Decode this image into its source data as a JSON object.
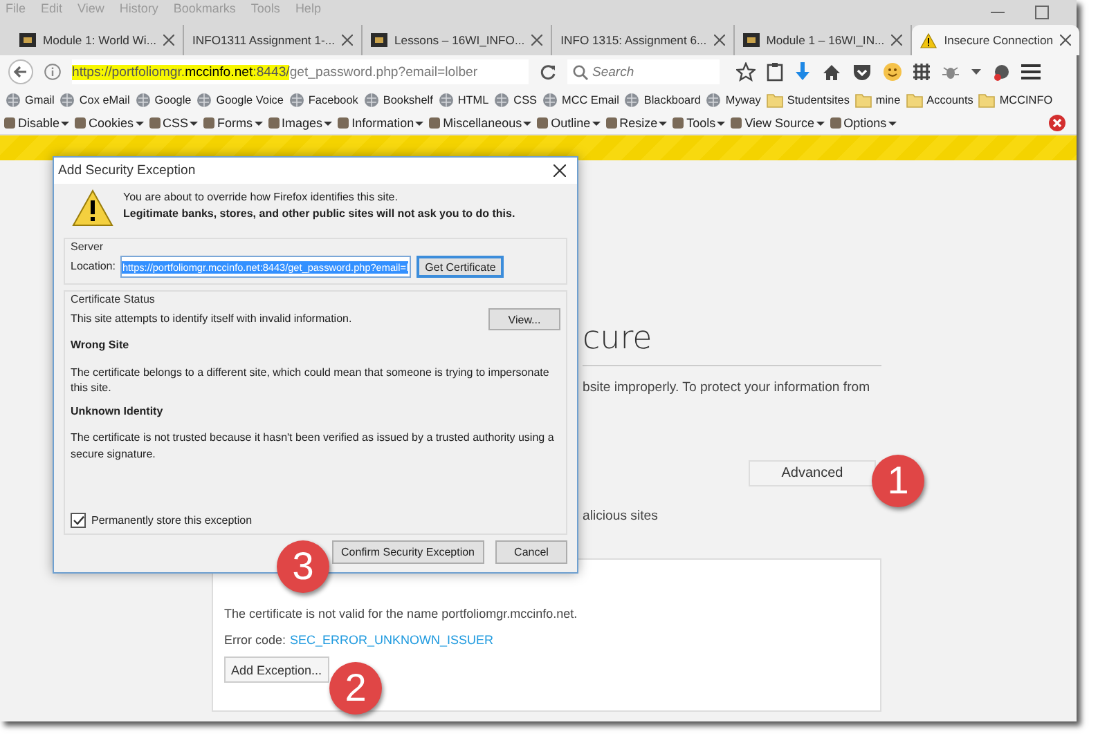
{
  "menu": [
    "File",
    "Edit",
    "View",
    "History",
    "Bookmarks",
    "Tools",
    "Help"
  ],
  "tabs": [
    {
      "title": "Module 1: World Wi...",
      "kind": "site",
      "selected": false
    },
    {
      "title": "INFO1311 Assignment 1-...",
      "kind": "plain",
      "selected": false
    },
    {
      "title": "Lessons – 16WI_INFO...",
      "kind": "site",
      "selected": false
    },
    {
      "title": "INFO 1315: Assignment 6...",
      "kind": "plain",
      "selected": false
    },
    {
      "title": "Module 1 – 16WI_IN...",
      "kind": "site",
      "selected": false
    },
    {
      "title": "Insecure Connection",
      "kind": "warning",
      "selected": true
    }
  ],
  "address": {
    "highlighted": "https://portfoliomgr.**mccinfo.net**:8443/",
    "rest": "get_password.php?email=lolber"
  },
  "search": {
    "placeholder": "Search"
  },
  "bookmarks": [
    {
      "label": "Gmail",
      "kind": "site"
    },
    {
      "label": "Cox eMail",
      "kind": "site"
    },
    {
      "label": "Google",
      "kind": "site"
    },
    {
      "label": "Google Voice",
      "kind": "site"
    },
    {
      "label": "Facebook",
      "kind": "site"
    },
    {
      "label": "Bookshelf",
      "kind": "site"
    },
    {
      "label": "HTML",
      "kind": "site"
    },
    {
      "label": "CSS",
      "kind": "site"
    },
    {
      "label": "MCC Email",
      "kind": "site"
    },
    {
      "label": "Blackboard",
      "kind": "site"
    },
    {
      "label": "Myway",
      "kind": "site"
    },
    {
      "label": "Studentsites",
      "kind": "folder"
    },
    {
      "label": "mine",
      "kind": "folder"
    },
    {
      "label": "Accounts",
      "kind": "folder"
    },
    {
      "label": "MCCINFO",
      "kind": "folder"
    }
  ],
  "dev_toolbar": [
    "Disable",
    "Cookies",
    "CSS",
    "Forms",
    "Images",
    "Information",
    "Miscellaneous",
    "Outline",
    "Resize",
    "Tools",
    "View Source",
    "Options"
  ],
  "page": {
    "heading": "cure",
    "paragraph": "bsite improperly. To protect your information from",
    "advanced_button": "Advanced",
    "note": "alicious sites",
    "panel": {
      "line": "The certificate is not valid for the name portfoliomgr.mccinfo.net.",
      "error_label": "Error code:",
      "error_code": "SEC_ERROR_UNKNOWN_ISSUER",
      "button": "Add Exception..."
    }
  },
  "dialog": {
    "title": "Add Security Exception",
    "intro": "You are about to override how Firefox identifies this site.",
    "warning": "Legitimate banks, stores, and other public sites will not ask you to do this.",
    "server": {
      "legend": "Server",
      "label": "Location:",
      "value": "https://portfoliomgr.mccinfo.net:8443/get_password.php?email=l",
      "button": "Get Certificate"
    },
    "status": {
      "legend": "Certificate Status",
      "summary": "This site attempts to identify itself with invalid information.",
      "button": "View...",
      "sections": [
        {
          "heading": "Wrong Site",
          "text": "The certificate belongs to a different site, which could mean that someone is trying to impersonate this site."
        },
        {
          "heading": "Unknown Identity",
          "text": "The certificate is not trusted because it hasn't been verified as issued by a trusted authority using a secure signature."
        }
      ]
    },
    "store": {
      "label": "Permanently store this exception",
      "checked": true
    },
    "buttons": [
      "Confirm Security Exception",
      "Cancel"
    ]
  },
  "callouts": [
    "1",
    "2",
    "3"
  ]
}
